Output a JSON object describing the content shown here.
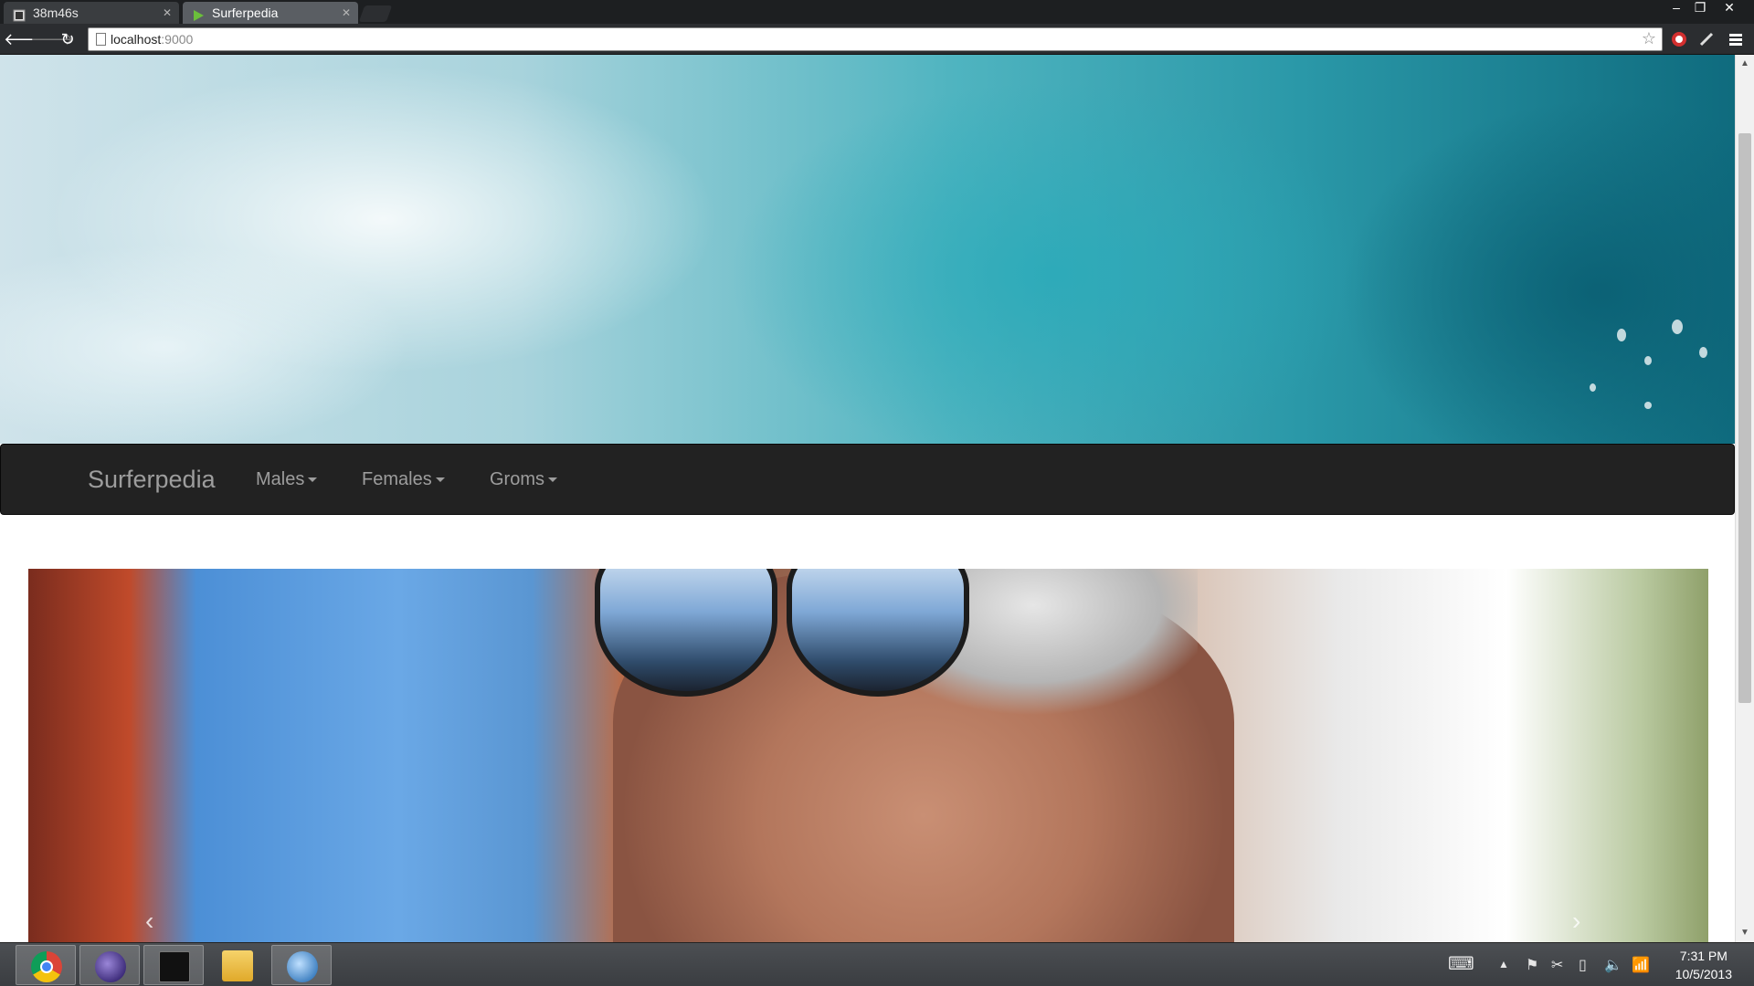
{
  "browser": {
    "tabs": [
      {
        "title": "38m46s",
        "active": false
      },
      {
        "title": "Surferpedia",
        "active": true
      }
    ],
    "address": {
      "host": "localhost",
      "port": ":9000"
    },
    "window_controls": {
      "minimize": "–",
      "restore": "❐",
      "close": "✕"
    }
  },
  "page": {
    "brand": "Surferpedia",
    "nav": [
      {
        "label": "Males"
      },
      {
        "label": "Females"
      },
      {
        "label": "Groms"
      }
    ],
    "carousel": {
      "prev": "‹",
      "next": "›"
    }
  },
  "taskbar": {
    "apps": [
      "chrome-icon",
      "eclipse-icon",
      "terminal-icon",
      "file-explorer-icon",
      "finch-icon"
    ],
    "clock": {
      "time": "7:31 PM",
      "date": "10/5/2013"
    }
  },
  "colors": {
    "navbar_bg": "#222222",
    "navbar_text": "#9d9d9d",
    "taskbar_bg": "#3a3d41"
  }
}
